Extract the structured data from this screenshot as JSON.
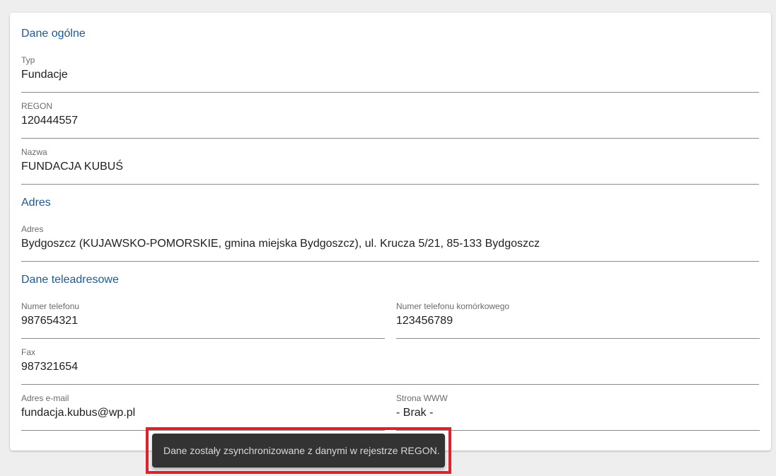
{
  "sections": {
    "general": {
      "title": "Dane ogólne",
      "type": {
        "label": "Typ",
        "value": "Fundacje"
      },
      "regon": {
        "label": "REGON",
        "value": "120444557"
      },
      "name": {
        "label": "Nazwa",
        "value": "FUNDACJA KUBUŚ"
      }
    },
    "address": {
      "title": "Adres",
      "address": {
        "label": "Adres",
        "value": "Bydgoszcz (KUJAWSKO-POMORSKIE, gmina miejska Bydgoszcz), ul. Krucza 5/21, 85-133 Bydgoszcz"
      }
    },
    "contact": {
      "title": "Dane teleadresowe",
      "phone": {
        "label": "Numer telefonu",
        "value": "987654321"
      },
      "mobile": {
        "label": "Numer telefonu komórkowego",
        "value": "123456789"
      },
      "fax": {
        "label": "Fax",
        "value": "987321654"
      },
      "email": {
        "label": "Adres e-mail",
        "value": "fundacja.kubus@wp.pl"
      },
      "website": {
        "label": "Strona WWW",
        "value": "- Brak -"
      }
    }
  },
  "toast": {
    "message": "Dane zostały zsynchronizowane z danymi w rejestrze REGON."
  },
  "colors": {
    "section_title": "#1c5a96",
    "toast_background": "#333333",
    "highlight_border": "#e0202a"
  }
}
